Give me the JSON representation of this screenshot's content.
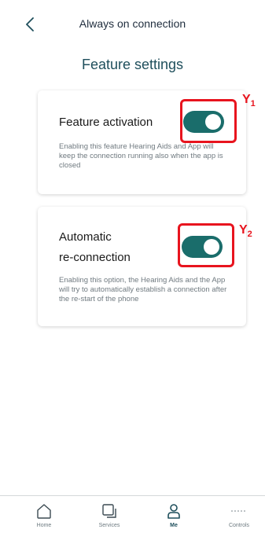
{
  "header": {
    "title": "Always on connection",
    "back_icon": "chevron-left-icon"
  },
  "page": {
    "title": "Feature settings"
  },
  "cards": [
    {
      "title": "Feature activation",
      "description": "Enabling this feature Hearing Aids and App will keep the connection running also when the app is closed",
      "toggle_on": true
    },
    {
      "title_line1": "Automatic",
      "title_line2": "re-connection",
      "description": "Enabling this option, the Hearing Aids and the App will try to automatically establish a connection after the re-start of the phone",
      "toggle_on": true
    }
  ],
  "annotations": [
    {
      "label": "Y",
      "sub": "1"
    },
    {
      "label": "Y",
      "sub": "2"
    }
  ],
  "bottom_nav": [
    {
      "label": "Home",
      "icon": "home-icon"
    },
    {
      "label": "Services",
      "icon": "services-icon"
    },
    {
      "label": "Me",
      "icon": "person-icon",
      "active": true
    },
    {
      "label": "Controls",
      "icon": "more-dots-icon"
    }
  ],
  "colors": {
    "toggle_on": "#1a6d6b",
    "highlight": "#e8141e",
    "title": "#1f4f5c"
  }
}
